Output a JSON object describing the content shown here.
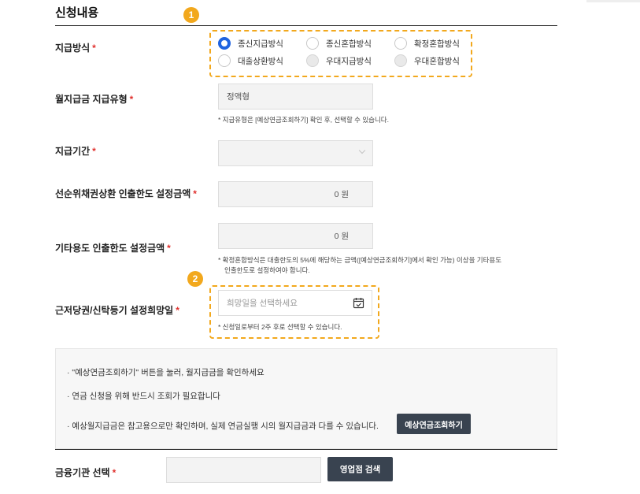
{
  "section": {
    "title": "신청내용"
  },
  "badges": [
    "1",
    "2"
  ],
  "payment_method": {
    "label": "지급방식",
    "required": "*",
    "options": [
      {
        "label": "종신지급방식",
        "state": "selected"
      },
      {
        "label": "종신혼합방식",
        "state": "normal"
      },
      {
        "label": "확정혼합방식",
        "state": "normal"
      },
      {
        "label": "대출상환방식",
        "state": "normal"
      },
      {
        "label": "우대지급방식",
        "state": "disabled"
      },
      {
        "label": "우대혼합방식",
        "state": "disabled"
      }
    ]
  },
  "monthly_type": {
    "label": "월지급금 지급유형",
    "required": "*",
    "value": "정액형",
    "hint": "* 지급유형은 [예상연금조회하기] 확인 후, 선택할 수 있습니다."
  },
  "period": {
    "label": "지급기간",
    "required": "*",
    "value": ""
  },
  "senior_limit": {
    "label": "선순위채권상환 인출한도 설정금액",
    "required": "*",
    "value": "0 원"
  },
  "other_limit": {
    "label": "기타용도 인출한도 설정금액",
    "required": "*",
    "value": "0 원",
    "hint_line1": "* 확정혼합방식은 대출한도의 5%에 해당하는 금액([예상연금조회하기]에서 확인 가능) 이상을 기타용도",
    "hint_line2": "인출한도로 설정하여야 합니다."
  },
  "mortgage_date": {
    "label": "근저당권/신탁등기 설정희망일",
    "required": "*",
    "placeholder": "희망일을 선택하세요",
    "hint": "* 신청일로부터 2주 후로 선택할 수 있습니다."
  },
  "info": {
    "line1": "\"예상연금조회하기\" 버튼을 눌러, 월지급금을 확인하세요",
    "line2": "연금 신청을 위해 반드시 조회가 필요합니다",
    "line3": "예상월지급금은 참고용으로만 확인하며, 실제 연금실행 시의 월지급금과 다를 수 있습니다.",
    "bullet": "·",
    "button": "예상연금조회하기"
  },
  "institution": {
    "label": "금융기관 선택",
    "required": "*",
    "value": "",
    "button": "영업점 검색"
  },
  "colors": {
    "accent": "#f2a81d",
    "radio_selected": "#1f63e0",
    "required": "#e0302d",
    "dark_button": "#394350"
  }
}
